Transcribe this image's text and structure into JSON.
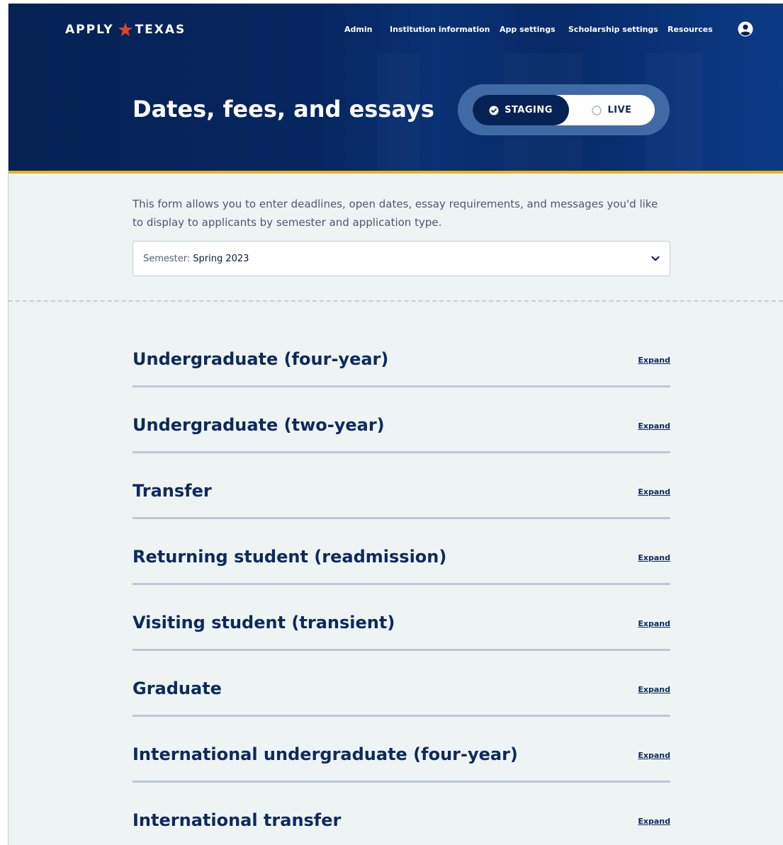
{
  "brand": {
    "logo_left": "APPLY",
    "logo_right": "TEXAS",
    "star_color": "#d64526"
  },
  "nav": {
    "items": [
      {
        "label": "Admin"
      },
      {
        "label": "Institution information"
      },
      {
        "label": "App settings"
      },
      {
        "label": "Scholarship settings"
      },
      {
        "label": "Resources"
      }
    ],
    "user_icon": "user-circle-icon"
  },
  "header": {
    "title": "Dates, fees, and essays",
    "toggle": {
      "staging_label": "STAGING",
      "live_label": "LIVE",
      "selected": "STAGING"
    }
  },
  "intro": {
    "text": "This form allows you to enter deadlines, open dates, essay requirements, and messages you'd like to display to applicants by semester and application type."
  },
  "semester_select": {
    "label": "Semester:",
    "value": "Spring 2023",
    "icon": "chevron-down-icon"
  },
  "sections": [
    {
      "title": "Undergraduate (four-year)",
      "action": "Expand"
    },
    {
      "title": "Undergraduate (two-year)",
      "action": "Expand"
    },
    {
      "title": "Transfer",
      "action": "Expand"
    },
    {
      "title": "Returning student (readmission)",
      "action": "Expand"
    },
    {
      "title": "Visiting student (transient)",
      "action": "Expand"
    },
    {
      "title": "Graduate",
      "action": "Expand"
    },
    {
      "title": "International undergraduate (four-year)",
      "action": "Expand"
    },
    {
      "title": "International transfer",
      "action": "Expand"
    }
  ],
  "colors": {
    "navy": "#062254",
    "accent_gold": "#e8b21e",
    "page_bg": "#eef4f4",
    "heading": "#0c2a5e"
  }
}
